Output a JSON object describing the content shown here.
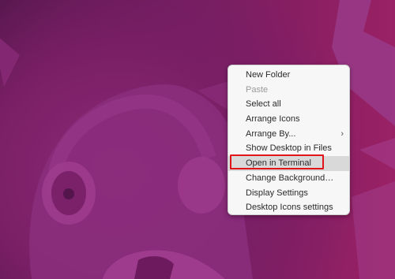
{
  "context_menu": {
    "items": [
      {
        "label": "New Folder"
      },
      {
        "label": "Paste"
      },
      {
        "label": "Select all"
      },
      {
        "label": "Arrange Icons"
      },
      {
        "label": "Arrange By...",
        "submenu_icon": "chevron-right-icon"
      },
      {
        "label": "Show Desktop in Files"
      },
      {
        "label": "Open in Terminal"
      },
      {
        "label": "Change Background…"
      },
      {
        "label": "Display Settings"
      },
      {
        "label": "Desktop Icons settings"
      }
    ],
    "disabled_item": "Paste",
    "highlighted_item": "Open in Terminal"
  },
  "annotation": {
    "highlight_color": "#e0141b"
  },
  "colors": {
    "wallpaper_dark": "#4f1648",
    "wallpaper_mid": "#7a1f66",
    "wallpaper_light": "#9a2165",
    "menu_background": "#f7f7f7"
  }
}
